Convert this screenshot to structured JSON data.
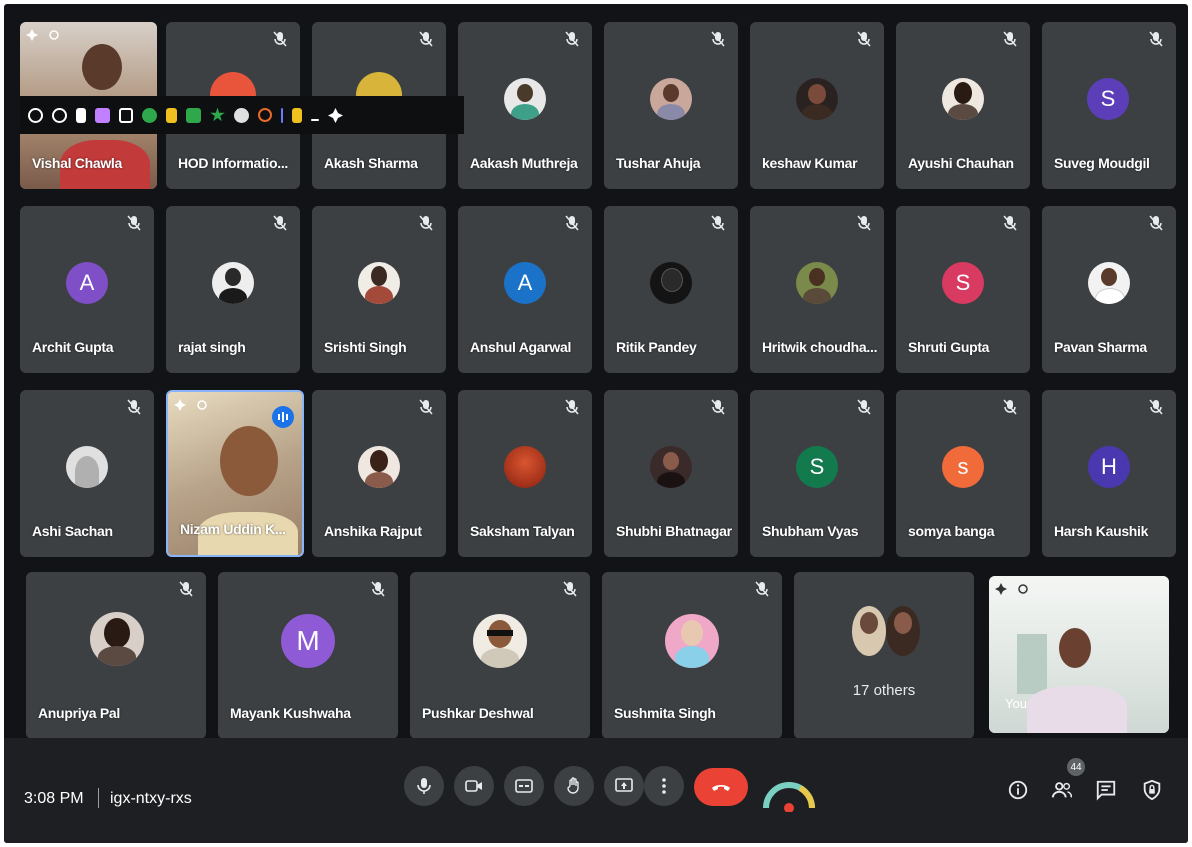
{
  "tiles_row1": [
    {
      "name": "Vishal Chawla",
      "kind": "video"
    },
    {
      "name": "HOD Informatio...",
      "kind": "photo",
      "color": "#e8553a"
    },
    {
      "name": "Akash Sharma",
      "kind": "photo",
      "color": "#d8b43a"
    },
    {
      "name": "Aakash Muthreja",
      "kind": "photo",
      "color": "#3fa08a"
    },
    {
      "name": "Tushar Ahuja",
      "kind": "photo",
      "color": "#c9a79b"
    },
    {
      "name": "keshaw Kumar",
      "kind": "photo",
      "color": "#4a3a33"
    },
    {
      "name": "Ayushi Chauhan",
      "kind": "photo",
      "color": "#5a4a42"
    },
    {
      "name": "Suveg Moudgil",
      "kind": "letter",
      "letter": "S",
      "color": "#5c3fb8"
    }
  ],
  "tiles_row2": [
    {
      "name": "Archit Gupta",
      "kind": "letter",
      "letter": "A",
      "color": "#7e4fc7"
    },
    {
      "name": "rajat singh",
      "kind": "photo",
      "color": "#eeeeee"
    },
    {
      "name": "Srishti Singh",
      "kind": "photo",
      "color": "#a44a3a"
    },
    {
      "name": "Anshul Agarwal",
      "kind": "letter",
      "letter": "A",
      "color": "#1a73c8"
    },
    {
      "name": "Ritik Pandey",
      "kind": "photo",
      "color": "#141414"
    },
    {
      "name": "Hritwik choudha...",
      "kind": "photo",
      "color": "#7a8a4a"
    },
    {
      "name": "Shruti Gupta",
      "kind": "letter",
      "letter": "S",
      "color": "#d93a62"
    },
    {
      "name": "Pavan Sharma",
      "kind": "photo",
      "color": "#f2f2f2"
    }
  ],
  "tiles_row3": [
    {
      "name": "Ashi Sachan",
      "kind": "photo",
      "color": "#e0e0e0"
    },
    {
      "name": "Nizam Uddin K...",
      "kind": "video"
    },
    {
      "name": "Anshika Rajput",
      "kind": "photo",
      "color": "#8a5a4a"
    },
    {
      "name": "Saksham Talyan",
      "kind": "photo",
      "color": "#a8331f"
    },
    {
      "name": "Shubhi Bhatnagar",
      "kind": "photo",
      "color": "#3a2a2a"
    },
    {
      "name": "Shubham Vyas",
      "kind": "letter",
      "letter": "S",
      "color": "#137a4e"
    },
    {
      "name": "somya banga",
      "kind": "letter",
      "letter": "s",
      "color": "#f06a3a"
    },
    {
      "name": "Harsh Kaushik",
      "kind": "letter",
      "letter": "H",
      "color": "#4a38b0"
    }
  ],
  "tiles_row4": [
    {
      "name": "Anupriya Pal",
      "kind": "photo",
      "color": "#5a4a42"
    },
    {
      "name": "Mayank Kushwaha",
      "kind": "letter",
      "letter": "M",
      "color": "#8e5ad6"
    },
    {
      "name": "Pushkar Deshwal",
      "kind": "photo",
      "color": "#f0ece4"
    },
    {
      "name": "Sushmita Singh",
      "kind": "photo",
      "color": "#f0a8c8"
    },
    {
      "name": "17 others",
      "kind": "others"
    },
    {
      "name": "You",
      "kind": "self-video"
    }
  ],
  "bottom_bar": {
    "time": "3:08 PM",
    "meeting_code": "igx-ntxy-rxs",
    "people_count": "44"
  },
  "colors": {
    "background": "#121316",
    "tile": "#3c4043",
    "end_call": "#ea4335",
    "active_speaker_border": "#8ab4f8"
  }
}
